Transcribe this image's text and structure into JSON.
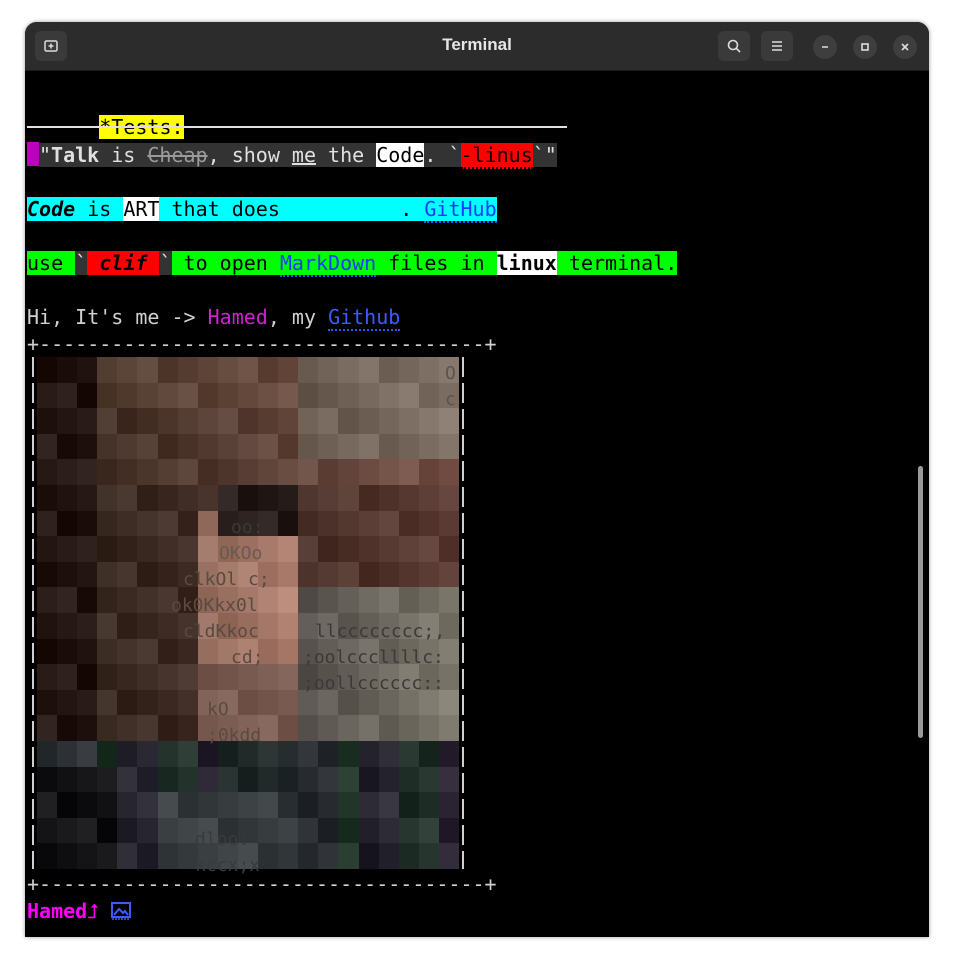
{
  "window": {
    "title": "Terminal"
  },
  "terminal": {
    "tests_label": "*Tests:",
    "quote": {
      "open_quote": "\"",
      "talk": "Talk",
      "is": " is ",
      "cheap": "Cheap",
      "show": ", show ",
      "me": "me",
      "the": " the ",
      "code": "Code",
      "dot": ". `",
      "linus": "-linus",
      "close": "`\""
    },
    "art_line": {
      "code": "Code",
      "is": " is ",
      "art": "ART",
      "that_does": " that does          . ",
      "github": "GitHub"
    },
    "use_line": {
      "use": "use ",
      "tick1": "`",
      "clif": " clif ",
      "tick2": "`",
      "to_open": " to open ",
      "markdown": "MarkDown",
      "files_in": " files in ",
      "linux": "linux",
      "terminal": " terminal."
    },
    "hi_line": {
      "hi": "Hi, It's me -> ",
      "hamed": "Hamed",
      "my": ", my ",
      "github": "Github"
    },
    "border_top": "+-------------------------------------+",
    "border_bottom": "+-------------------------------------+",
    "ascii_texts": {
      "r1": "O",
      "r2": "c",
      "r7": "oo:",
      "r8": "OKOo",
      "r9": "clkOl c;",
      "r10": "ok0Kkx0l",
      "r11": "cldKkoc",
      "r11b": "llcccccccc;,",
      "r12": "cd;",
      "r12b": ";oolcccllllc:",
      "r13b": ";oollcccccc::",
      "r14": "kO",
      "r15": ";0kdd",
      "r19": "dloo:",
      "r20": "kccx;x"
    },
    "prompt": {
      "user": "Hamed",
      "symbol": "⮥"
    }
  },
  "colors": {
    "prompt": "#ff00ff",
    "link": "#3b5bff",
    "hamed": "#d020d0",
    "inline_code_bg": "#ff0000"
  }
}
